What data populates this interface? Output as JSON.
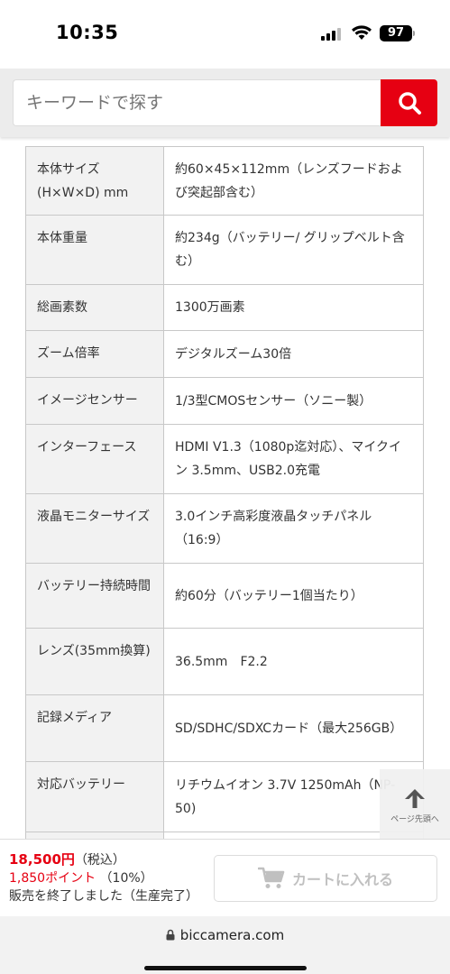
{
  "status_bar": {
    "time": "10:35",
    "battery": "97"
  },
  "search": {
    "placeholder": "キーワードで探す"
  },
  "spec_rows": [
    {
      "label": "本体サイズ(H×W×D) mm",
      "value": "約60×45×112mm（レンズフードおよび突起部含む）"
    },
    {
      "label": "本体重量",
      "value": "約234g（バッテリー/ グリップベルト含む）"
    },
    {
      "label": "総画素数",
      "value": "1300万画素"
    },
    {
      "label": "ズーム倍率",
      "value": "デジタルズーム30倍"
    },
    {
      "label": "イメージセンサー",
      "value": "1/3型CMOSセンサー（ソニー製）"
    },
    {
      "label": "インターフェース",
      "value": "HDMI V1.3（1080p迄対応）、マイクイン 3.5mm、USB2.0充電"
    },
    {
      "label": "液晶モニターサイズ",
      "value": "3.0インチ高彩度液晶タッチパネル（16:9）"
    },
    {
      "label": "バッテリー持続時間",
      "value": "約60分（バッテリー1個当たり）"
    },
    {
      "label": "レンズ(35mm換算)",
      "value": "36.5mm　F2.2"
    },
    {
      "label": "記録メディア",
      "value": "SD/SDHC/SDXCカード（最大256GB）"
    },
    {
      "label": "対応バッテリー",
      "value": "リチウムイオン 3.7V 1250mAh（NP-50)"
    }
  ],
  "page_top": {
    "label": "ページ先頭へ"
  },
  "purchase": {
    "price": "18,500円",
    "tax": "（税込）",
    "points": "1,850ポイント",
    "points_rate": "（10%）",
    "status": "販売を終了しました（生産完了）",
    "cart_label": "カートに入れる"
  },
  "browser": {
    "url": "biccamera.com"
  },
  "colors": {
    "accent": "#e60012",
    "label_bg": "#f2f2f2",
    "border": "#c8c8c8"
  }
}
